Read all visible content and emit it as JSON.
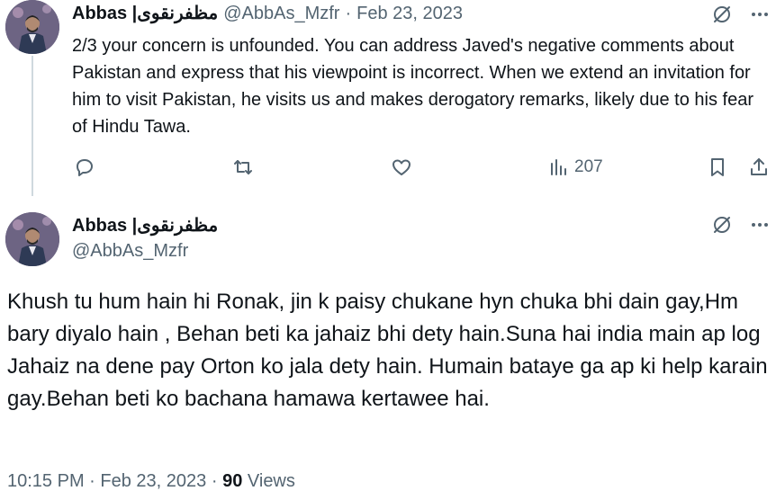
{
  "tweet1": {
    "display_name": "Abbas |مظفرنقوی",
    "handle": "@AbbAs_Mzfr",
    "separator": "·",
    "date": "Feb 23, 2023",
    "text": "2/3 your concern is unfounded. You can address Javed's negative comments about Pakistan and express that his viewpoint is incorrect. When we extend an invitation for him to visit Pakistan, he visits us and makes derogatory remarks, likely due to his fear of Hindu Tawa.",
    "views": "207"
  },
  "tweet2": {
    "display_name": "Abbas |مظفرنقوی",
    "handle": "@AbbAs_Mzfr",
    "text": "Khush tu hum hain hi Ronak, jin k paisy chukane hyn chuka bhi dain gay,Hm bary diyalo hain , Behan beti ka jahaiz bhi dety hain.Suna hai india main ap log Jahaiz na dene pay Orton ko jala dety hain. Humain bataye ga ap ki help karain gay.Behan beti ko bachana hamawa kertawee hai.",
    "time": "10:15 PM",
    "separator": "·",
    "date": "Feb 23, 2023",
    "view_count": "90",
    "views_label": "Views"
  },
  "icons": {
    "grok": "grok-icon",
    "more": "more-icon",
    "reply": "reply-icon",
    "retweet": "retweet-icon",
    "like": "like-icon",
    "views": "views-icon",
    "bookmark": "bookmark-icon",
    "share": "share-icon"
  },
  "colors": {
    "text": "#0f1419",
    "secondary": "#536471",
    "thread_line": "#cfd9de"
  }
}
